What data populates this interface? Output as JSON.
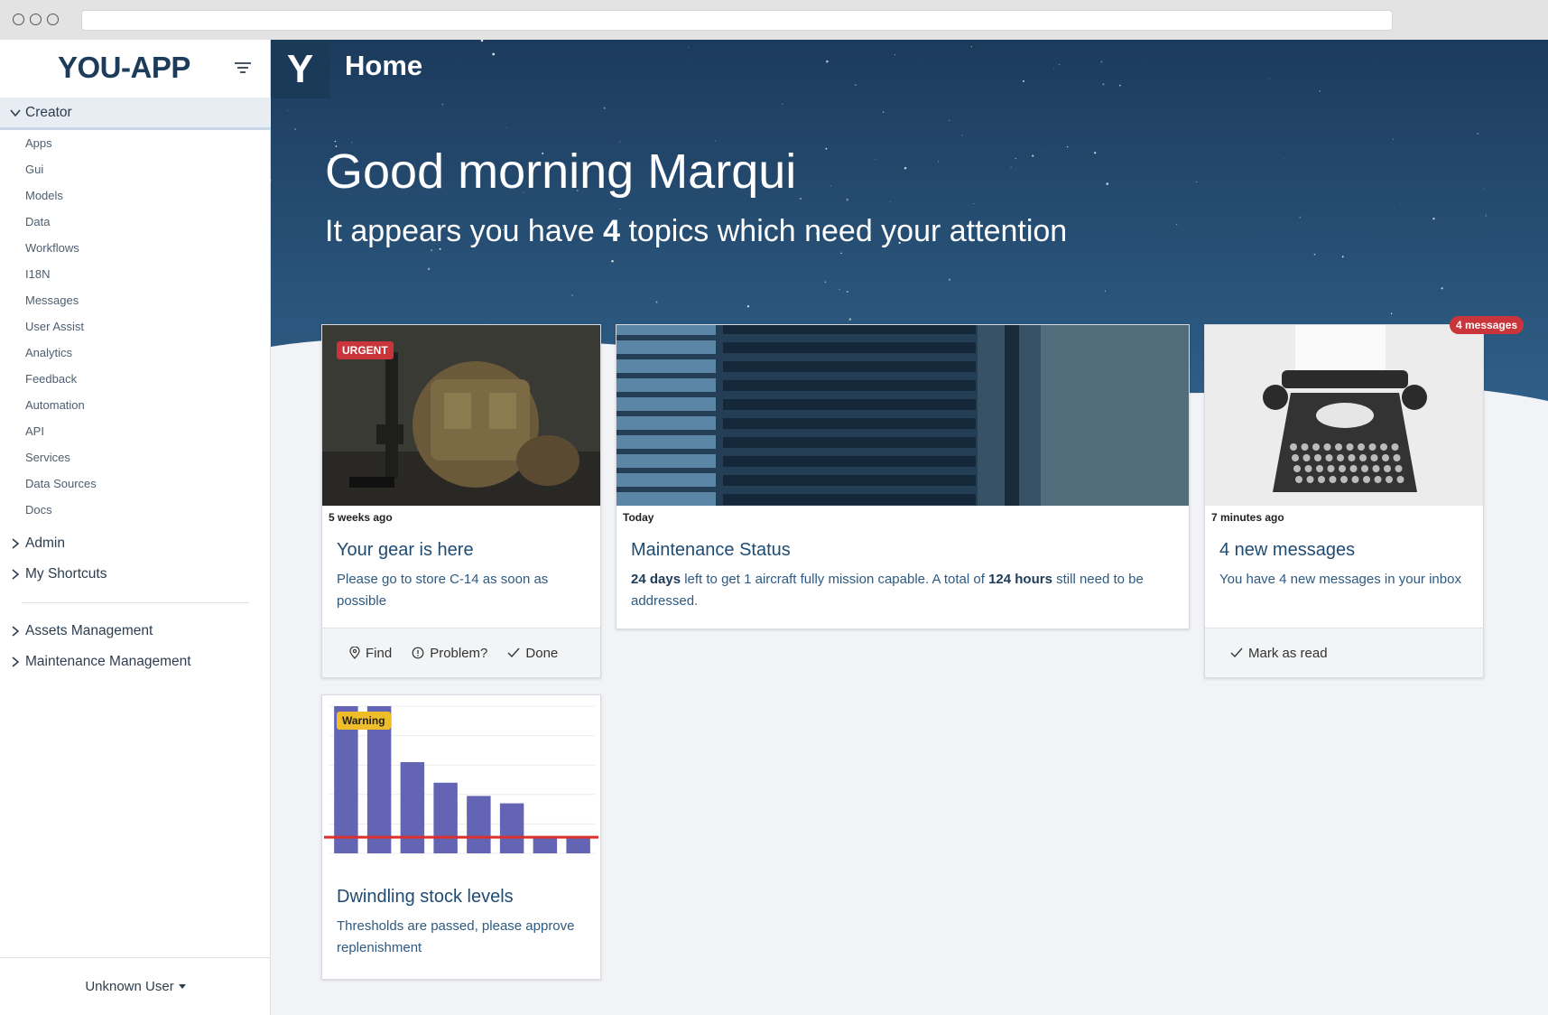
{
  "app": {
    "brand": "YOU-APP",
    "logo_letter": "Y",
    "page_title": "Home"
  },
  "sidebar": {
    "groups": [
      {
        "label": "Creator",
        "expanded": true
      },
      {
        "label": "Admin",
        "expanded": false
      },
      {
        "label": "My Shortcuts",
        "expanded": false
      },
      {
        "label": "Assets Management",
        "expanded": false
      },
      {
        "label": "Maintenance Management",
        "expanded": false
      }
    ],
    "creator_items": [
      "Apps",
      "Gui",
      "Models",
      "Data",
      "Workflows",
      "I18N",
      "Messages",
      "User Assist",
      "Analytics",
      "Feedback",
      "Automation",
      "API",
      "Services",
      "Data Sources",
      "Docs"
    ],
    "user": "Unknown User"
  },
  "hero": {
    "greeting": "Good morning Marqui",
    "sub_prefix": "It appears you have ",
    "topic_count": "4",
    "sub_suffix": " topics which need your attention"
  },
  "cards": {
    "gear": {
      "badge": "URGENT",
      "meta": "5 weeks ago",
      "title": "Your gear is here",
      "text": "Please go to store C-14 as soon as possible",
      "actions": [
        "Find",
        "Problem?",
        "Done"
      ]
    },
    "maintenance": {
      "meta": "Today",
      "title": "Maintenance Status",
      "days": "24 days",
      "text_mid": " left to get 1 aircraft fully mission capable. A total of ",
      "hours": "124 hours",
      "text_end": " still need to be addressed."
    },
    "messages": {
      "badge": "4 messages",
      "meta": "7 minutes ago",
      "title": "4 new messages",
      "text": "You have 4 new messages in your inbox",
      "action": "Mark as read"
    },
    "stock": {
      "badge": "Warning",
      "title": "Dwindling stock levels",
      "text": "Thresholds are passed, please approve replenishment"
    }
  },
  "chart_data": {
    "type": "bar",
    "values": [
      100,
      100,
      62,
      48,
      39,
      34,
      11,
      11
    ],
    "threshold": 11,
    "ylim": [
      0,
      100
    ],
    "bar_color": "#6464b4",
    "threshold_color": "#d9312b"
  },
  "colors": {
    "hero_top": "#1c3b5d",
    "hero_bottom": "#2f5e86",
    "accent": "#1f4b73",
    "urgent": "#c9353a",
    "warning": "#f0bd2a"
  }
}
